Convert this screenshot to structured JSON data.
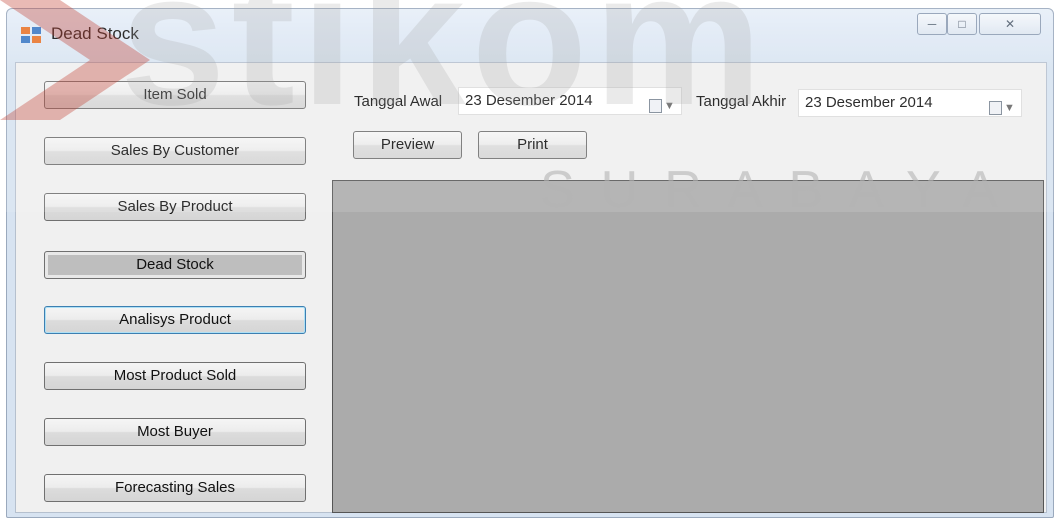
{
  "window": {
    "title": "Dead Stock"
  },
  "nav": {
    "items": [
      {
        "label": "Item Sold"
      },
      {
        "label": "Sales By Customer"
      },
      {
        "label": "Sales By Product"
      },
      {
        "label": "Dead Stock",
        "state": "active"
      },
      {
        "label": "Analisys Product",
        "state": "focused"
      },
      {
        "label": "Most Product Sold"
      },
      {
        "label": "Most Buyer"
      },
      {
        "label": "Forecasting Sales"
      }
    ]
  },
  "filters": {
    "start_label": "Tanggal Awal",
    "start_value": "23 Desember 2014",
    "end_label": "Tanggal Akhir",
    "end_value": "23 Desember 2014"
  },
  "actions": {
    "preview_label": "Preview",
    "print_label": "Print"
  },
  "watermark": {
    "logo_text": "stikom",
    "city_text": "SURABAYA",
    "accent_color": "#c0392b"
  },
  "icons": {
    "app": "form-icon",
    "minimize": "minimize-icon",
    "maximize": "maximize-icon",
    "close": "close-icon",
    "calendar": "calendar-icon"
  }
}
